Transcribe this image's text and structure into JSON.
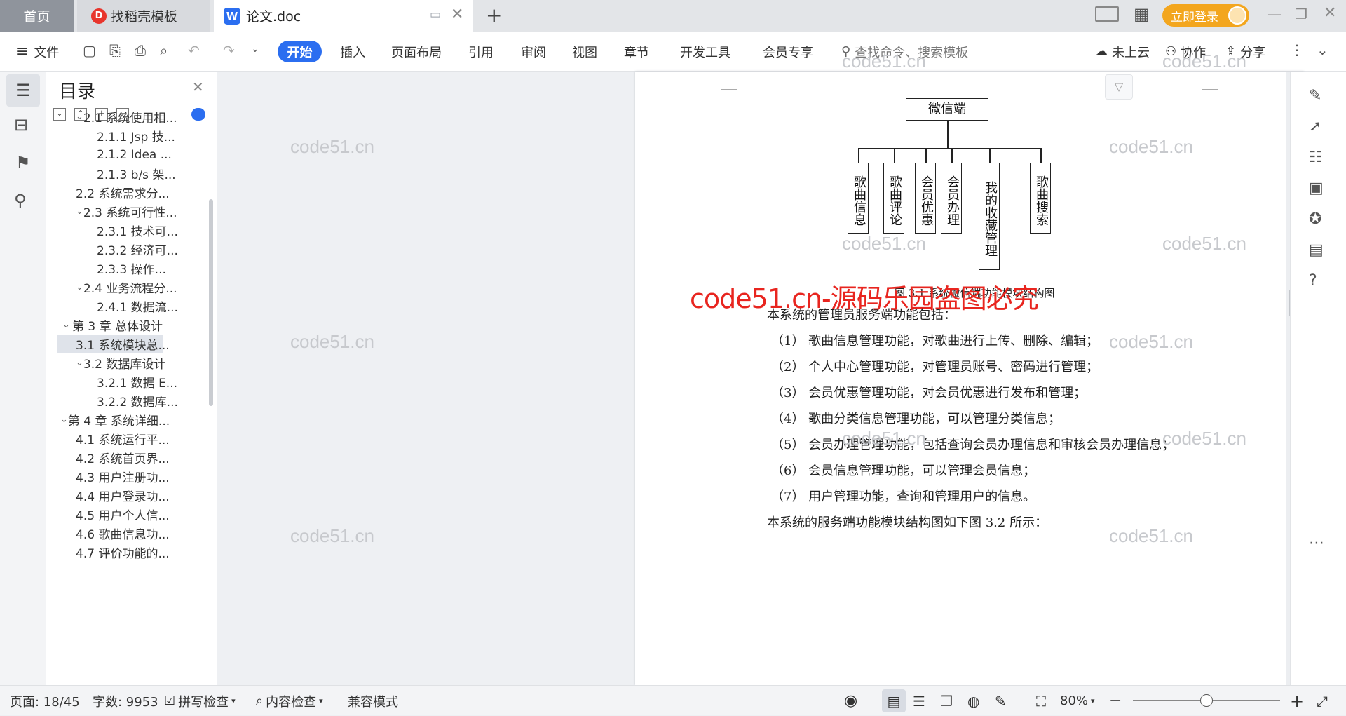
{
  "tabs": {
    "home": "首页",
    "template": "找稻壳模板",
    "doc": "论文.doc",
    "doc_logo": "W",
    "template_logo": "D",
    "new_tab": "+",
    "login": "立即登录"
  },
  "menu": {
    "file": "文件",
    "items": [
      "开始",
      "插入",
      "页面布局",
      "引用",
      "审阅",
      "视图",
      "章节",
      "开发工具",
      "会员专享"
    ],
    "search_placeholder": "查找命令、搜索模板",
    "cloud": "未上云",
    "collab": "协作",
    "share": "分享"
  },
  "toc": {
    "title": "目录",
    "items": [
      {
        "label": "2.1 系统使用相...",
        "level": 2,
        "expand": true
      },
      {
        "label": "2.1.1 Jsp 技...",
        "level": 3
      },
      {
        "label": "2.1.2 Idea ...",
        "level": 3
      },
      {
        "label": "2.1.3 b/s 架...",
        "level": 3
      },
      {
        "label": "2.2 系统需求分...",
        "level": 2
      },
      {
        "label": "2.3 系统可行性...",
        "level": 2,
        "expand": true
      },
      {
        "label": "2.3.1 技术可...",
        "level": 3
      },
      {
        "label": "2.3.2 经济可...",
        "level": 3
      },
      {
        "label": "2.3.3  操作...",
        "level": 3
      },
      {
        "label": "2.4 业务流程分...",
        "level": 2,
        "expand": true
      },
      {
        "label": "2.4.1 数据流...",
        "level": 3
      },
      {
        "label": "第 3 章  总体设计",
        "level": 1,
        "expand": true
      },
      {
        "label": "3.1 系统模块总...",
        "level": 2,
        "selected": true
      },
      {
        "label": "3.2 数据库设计",
        "level": 2,
        "expand": true
      },
      {
        "label": "3.2.1 数据 E...",
        "level": 3
      },
      {
        "label": "3.2.2 数据库...",
        "level": 3
      },
      {
        "label": "第 4 章    系统详细...",
        "level": 1,
        "expand": true
      },
      {
        "label": "4.1 系统运行平...",
        "level": 2
      },
      {
        "label": "4.2 系统首页界...",
        "level": 2
      },
      {
        "label": "4.3 用户注册功...",
        "level": 2
      },
      {
        "label": "4.4 用户登录功...",
        "level": 2
      },
      {
        "label": "4.5 用户个人信...",
        "level": 2
      },
      {
        "label": "4.6 歌曲信息功...",
        "level": 2
      },
      {
        "label": "4.7 评价功能的...",
        "level": 2
      }
    ]
  },
  "diagram": {
    "root": "微信端",
    "children": [
      "歌曲信息",
      "歌曲评论",
      "会员优惠",
      "会员办理",
      "我的收藏管理",
      "歌曲搜索"
    ]
  },
  "document": {
    "caption": "图 3.1 系统微信端功能模块结构图",
    "intro": "本系统的管理员服务端功能包括：",
    "items": [
      "（1）  歌曲信息管理功能，对歌曲进行上传、删除、编辑；",
      "（2）  个人中心管理功能，对管理员账号、密码进行管理；",
      "（3）  会员优惠管理功能，对会员优惠进行发布和管理；",
      "（4）  歌曲分类信息管理功能，可以管理分类信息；",
      "（5）  会员办理管理功能，包括查询会员办理信息和审核会员办理信息；",
      "（6）  会员信息管理功能，可以管理会员信息；",
      "（7）  用户管理功能，查询和管理用户的信息。"
    ],
    "closing": "本系统的服务端功能模块结构图如下图 3.2 所示："
  },
  "watermark": {
    "small": "code51.cn",
    "big": "code51.cn-源码乐园盗图必究"
  },
  "status": {
    "page": "页面: 18/45",
    "words": "字数: 9953",
    "spell": "拼写检查",
    "content_check": "内容检查",
    "compat": "兼容模式",
    "zoom": "80%",
    "zoom_minus": "−",
    "zoom_plus": "+",
    "zoom_level": 0.5
  },
  "colors": {
    "accent": "#2b6ef0",
    "login": "#f3a61e",
    "watermark_red": "#e8251f"
  }
}
